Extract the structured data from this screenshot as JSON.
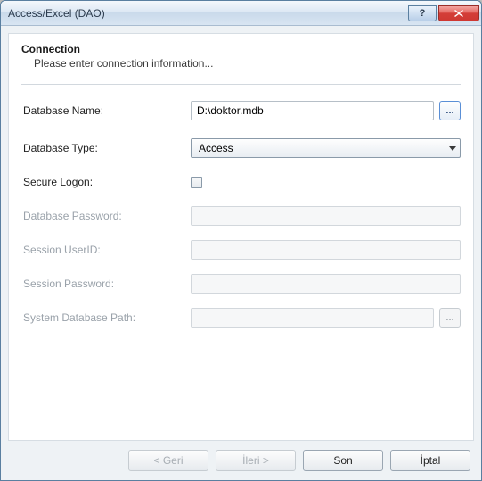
{
  "window": {
    "title": "Access/Excel (DAO)"
  },
  "header": {
    "title": "Connection",
    "subtitle": "Please enter connection information..."
  },
  "form": {
    "databaseName": {
      "label": "Database Name:",
      "value": "D:\\doktor.mdb"
    },
    "databaseType": {
      "label": "Database Type:",
      "value": "Access"
    },
    "secureLogon": {
      "label": "Secure Logon:"
    },
    "dbPassword": {
      "label": "Database Password:"
    },
    "sessionUser": {
      "label": "Session UserID:"
    },
    "sessionPassword": {
      "label": "Session Password:"
    },
    "systemDbPath": {
      "label": "System Database Path:"
    },
    "browse": "...",
    "browse2": "..."
  },
  "buttons": {
    "back": "< Geri",
    "next": "İleri >",
    "finish": "Son",
    "cancel": "İptal"
  }
}
